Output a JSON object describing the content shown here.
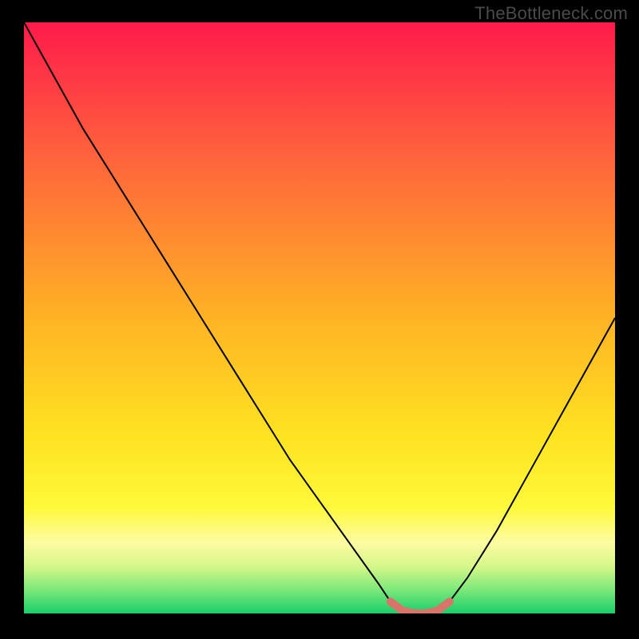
{
  "watermark": {
    "text": "TheBottleneck.com"
  },
  "chart_data": {
    "type": "line",
    "title": "",
    "xlabel": "",
    "ylabel": "",
    "xlim": [
      0,
      100
    ],
    "ylim": [
      0,
      100
    ],
    "grid": false,
    "legend": false,
    "x": [
      0,
      5,
      10,
      15,
      20,
      25,
      30,
      35,
      40,
      45,
      50,
      55,
      60,
      62,
      64,
      66,
      68,
      70,
      72,
      75,
      80,
      85,
      90,
      95,
      100
    ],
    "values": [
      100,
      91,
      82,
      74,
      66,
      58,
      50,
      42,
      34,
      26,
      19,
      12,
      5,
      2,
      0.5,
      0,
      0,
      0.5,
      2,
      6,
      14,
      23,
      32,
      41,
      50
    ],
    "marker_segment": {
      "x": [
        62,
        64,
        66,
        68,
        70,
        72
      ],
      "values": [
        2,
        0.5,
        0,
        0,
        0.5,
        2
      ],
      "color": "#d9746b",
      "width": 10
    },
    "background_gradient": {
      "direction": "vertical",
      "stops": [
        {
          "offset": 0.0,
          "color": "#ff1a4b"
        },
        {
          "offset": 0.25,
          "color": "#ff6a3a"
        },
        {
          "offset": 0.5,
          "color": "#ffb324"
        },
        {
          "offset": 0.7,
          "color": "#ffe321"
        },
        {
          "offset": 0.82,
          "color": "#fff93a"
        },
        {
          "offset": 0.88,
          "color": "#fdfca2"
        },
        {
          "offset": 0.92,
          "color": "#d6f78a"
        },
        {
          "offset": 0.96,
          "color": "#7de87a"
        },
        {
          "offset": 1.0,
          "color": "#19ce6b"
        }
      ]
    },
    "curve_color": "#000000",
    "curve_width": 2
  }
}
